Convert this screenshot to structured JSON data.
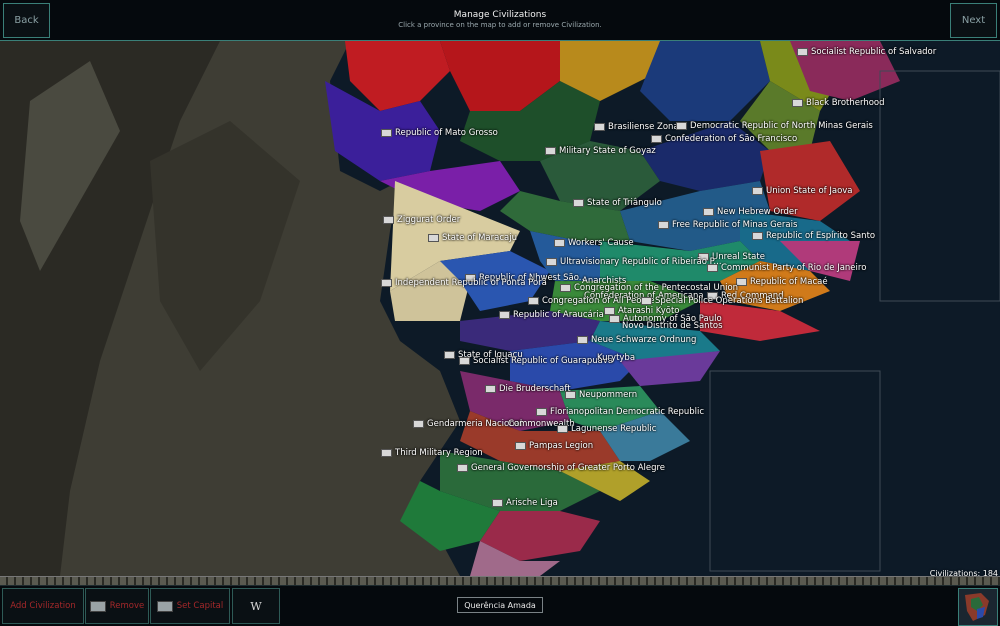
{
  "header": {
    "back_label": "Back",
    "next_label": "Next",
    "title": "Manage Civilizations",
    "subtitle": "Click a province on the map to add or remove Civilization."
  },
  "map": {
    "labels": [
      {
        "text": "Socialist Republic of Salvador"
      },
      {
        "text": "Black Brotherhood"
      },
      {
        "text": "Republic of Mato Grosso"
      },
      {
        "text": "Brasiliense Zona"
      },
      {
        "text": "Democratic Republic of North Minas Gerais"
      },
      {
        "text": "Confederation of São Francisco"
      },
      {
        "text": "Military State of Goyaz"
      },
      {
        "text": "Union State of Jaova"
      },
      {
        "text": "State of Triângulo"
      },
      {
        "text": "New Hebrew Order"
      },
      {
        "text": "Ziggurat Order"
      },
      {
        "text": "Free Republic of Minas Gerais"
      },
      {
        "text": "Republic of Espírito Santo"
      },
      {
        "text": "State of Maracaju"
      },
      {
        "text": "Workers' Cause"
      },
      {
        "text": "Unreal State"
      },
      {
        "text": "Ultravisionary Republic of Ribeirão P..."
      },
      {
        "text": "Communist Party of Rio de Janeiro"
      },
      {
        "text": "Republic of N..."
      },
      {
        "text": "...hwest São..."
      },
      {
        "text": "Independent Republic of Ponta Porã"
      },
      {
        "text": "Anarchists"
      },
      {
        "text": "Republic of Macaé"
      },
      {
        "text": "Congregation of the Pentecostal Union"
      },
      {
        "text": "Confederation of Americana"
      },
      {
        "text": "Red Command"
      },
      {
        "text": "Congregation of All People"
      },
      {
        "text": "Special Police Operations Battalion"
      },
      {
        "text": "Atarashi Kyōto"
      },
      {
        "text": "Republic of Araucária"
      },
      {
        "text": "Autonomy of São Paulo"
      },
      {
        "text": "Novo Distrito de Santos"
      },
      {
        "text": "Neue Schwarze Ordnung"
      },
      {
        "text": "State of Iguaçu"
      },
      {
        "text": "Socialist Republic of Guarapuava"
      },
      {
        "text": "Kurytyba"
      },
      {
        "text": "Die Bruderschaft"
      },
      {
        "text": "Neupommern"
      },
      {
        "text": "Florianopolitan Democratic Republic"
      },
      {
        "text": "Gendarmeria Nacional"
      },
      {
        "text": "Commonwealth"
      },
      {
        "text": "Lagunense Republic"
      },
      {
        "text": "Pampas Legion"
      },
      {
        "text": "Third Military Region"
      },
      {
        "text": "General Governorship of Greater Porto Alegre"
      },
      {
        "text": "Arische Liga"
      }
    ],
    "civilizations_count": "Civilizations: 184"
  },
  "footer": {
    "add_label": "Add Civilization",
    "remove_label": "Remove",
    "set_capital_label": "Set Capital",
    "w_label": "W",
    "selected_civ": "Querência Amada"
  }
}
